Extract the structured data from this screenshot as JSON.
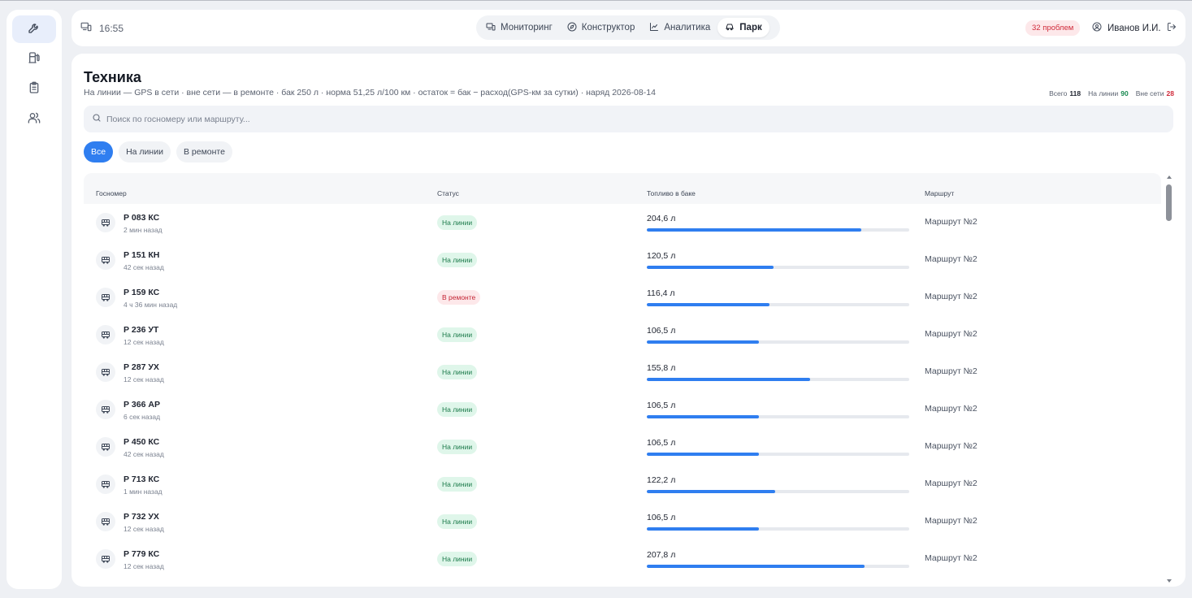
{
  "sidebar": {
    "items": [
      {
        "icon": "wrench-icon",
        "active": true
      },
      {
        "icon": "fuel-pump-icon",
        "active": false
      },
      {
        "icon": "clipboard-icon",
        "active": false
      },
      {
        "icon": "users-icon",
        "active": false
      }
    ]
  },
  "topbar": {
    "time": "16:55",
    "tabs": [
      {
        "label": "Мониторинг",
        "icon": "monitor-icon",
        "active": false
      },
      {
        "label": "Конструктор",
        "icon": "compass-icon",
        "active": false
      },
      {
        "label": "Аналитика",
        "icon": "chart-icon",
        "active": false
      },
      {
        "label": "Парк",
        "icon": "car-icon",
        "active": true
      }
    ],
    "problems_label": "32 проблем",
    "user_name": "Иванов И.И."
  },
  "page": {
    "title": "Техника",
    "subtitle": "На линии — GPS в сети · вне сети — в ремонте · бак 250 л · норма 51,25 л/100 км · остаток = бак − расход(GPS-км за сутки) · наряд 2026-08-14",
    "stats": {
      "total_label": "Всего",
      "total_value": "118",
      "online_label": "На линии",
      "online_value": "90",
      "offline_label": "Вне сети",
      "offline_value": "28"
    },
    "search_placeholder": "Поиск по госномеру или маршруту...",
    "filters": [
      {
        "label": "Все",
        "active": true
      },
      {
        "label": "На линии",
        "active": false
      },
      {
        "label": "В ремонте",
        "active": false
      }
    ]
  },
  "table": {
    "columns": [
      "Госномер",
      "Статус",
      "Топливо в баке",
      "Маршрут"
    ],
    "tank_capacity_l": 250,
    "rows": [
      {
        "plate": "Р 083 КС",
        "ago": "2 мин назад",
        "status": "На линии",
        "status_kind": "ok",
        "fuel": "204,6 л",
        "fuel_l": 204.6,
        "route": "Маршрут №2"
      },
      {
        "plate": "Р 151 КН",
        "ago": "42 сек назад",
        "status": "На линии",
        "status_kind": "ok",
        "fuel": "120,5 л",
        "fuel_l": 120.5,
        "route": "Маршрут №2"
      },
      {
        "plate": "Р 159 КС",
        "ago": "4 ч 36 мин назад",
        "status": "В ремонте",
        "status_kind": "repair",
        "fuel": "116,4 л",
        "fuel_l": 116.4,
        "route": "Маршрут №2"
      },
      {
        "plate": "Р 236 УТ",
        "ago": "12 сек назад",
        "status": "На линии",
        "status_kind": "ok",
        "fuel": "106,5 л",
        "fuel_l": 106.5,
        "route": "Маршрут №2"
      },
      {
        "plate": "Р 287 УХ",
        "ago": "12 сек назад",
        "status": "На линии",
        "status_kind": "ok",
        "fuel": "155,8 л",
        "fuel_l": 155.8,
        "route": "Маршрут №2"
      },
      {
        "plate": "Р 366 АР",
        "ago": "6 сек назад",
        "status": "На линии",
        "status_kind": "ok",
        "fuel": "106,5 л",
        "fuel_l": 106.5,
        "route": "Маршрут №2"
      },
      {
        "plate": "Р 450 КС",
        "ago": "42 сек назад",
        "status": "На линии",
        "status_kind": "ok",
        "fuel": "106,5 л",
        "fuel_l": 106.5,
        "route": "Маршрут №2"
      },
      {
        "plate": "Р 713 КС",
        "ago": "1 мин назад",
        "status": "На линии",
        "status_kind": "ok",
        "fuel": "122,2 л",
        "fuel_l": 122.2,
        "route": "Маршрут №2"
      },
      {
        "plate": "Р 732 УХ",
        "ago": "12 сек назад",
        "status": "На линии",
        "status_kind": "ok",
        "fuel": "106,5 л",
        "fuel_l": 106.5,
        "route": "Маршрут №2"
      },
      {
        "plate": "Р 779 КС",
        "ago": "12 сек назад",
        "status": "На линии",
        "status_kind": "ok",
        "fuel": "207,8 л",
        "fuel_l": 207.8,
        "route": "Маршрут №2"
      }
    ]
  },
  "colors": {
    "accent": "#2f7ef0",
    "ok_bg": "#dff6ea",
    "ok_text": "#1b7a4a",
    "repair_bg": "#fde8ea",
    "repair_text": "#c42434"
  }
}
